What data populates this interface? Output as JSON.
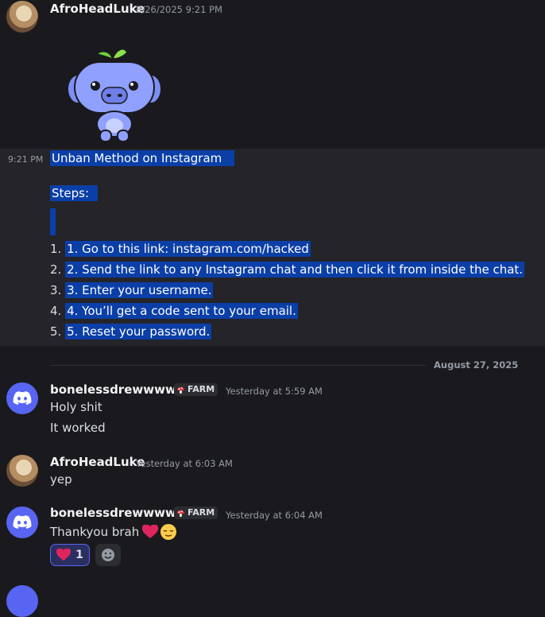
{
  "messages": [
    {
      "author": "AfroHeadLuke",
      "timestamp": "8/26/2025 9:21 PM",
      "sticker": "wumpus-sticker"
    },
    {
      "hover_time": "9:21 PM",
      "lines": [
        "Unban Method on Instagram",
        "Steps:",
        "1. Go to this link: instagram.com/hacked",
        "2. Send the link to any Instagram chat and then click it from inside the chat.",
        "3. Enter your username.",
        "4. You’ll get a code sent to your email.",
        "5. Reset your password."
      ]
    }
  ],
  "date_divider": "August 27, 2025",
  "msg_bone1": {
    "author": "bonelessdrewwwwww",
    "tag": "FARM",
    "timestamp": "Yesterday at 5:59 AM",
    "lines": [
      "Holy shit",
      "It worked"
    ]
  },
  "msg_luke2": {
    "author": "AfroHeadLuke",
    "timestamp": "Yesterday at 6:03 AM",
    "lines": [
      "yep"
    ]
  },
  "msg_bone2": {
    "author": "bonelessdrewwwwww",
    "tag": "FARM",
    "timestamp": "Yesterday at 6:04 AM",
    "text": "Thankyou brah",
    "emojis": [
      "red-heart-emoji",
      "relieved-face-emoji"
    ],
    "reaction": {
      "emoji": "red-heart-emoji",
      "count": "1"
    }
  },
  "colors": {
    "background": "#1a1a1e",
    "selection": "#0b3fa8",
    "blurple": "#5865f2",
    "heart": "#e0245e"
  }
}
